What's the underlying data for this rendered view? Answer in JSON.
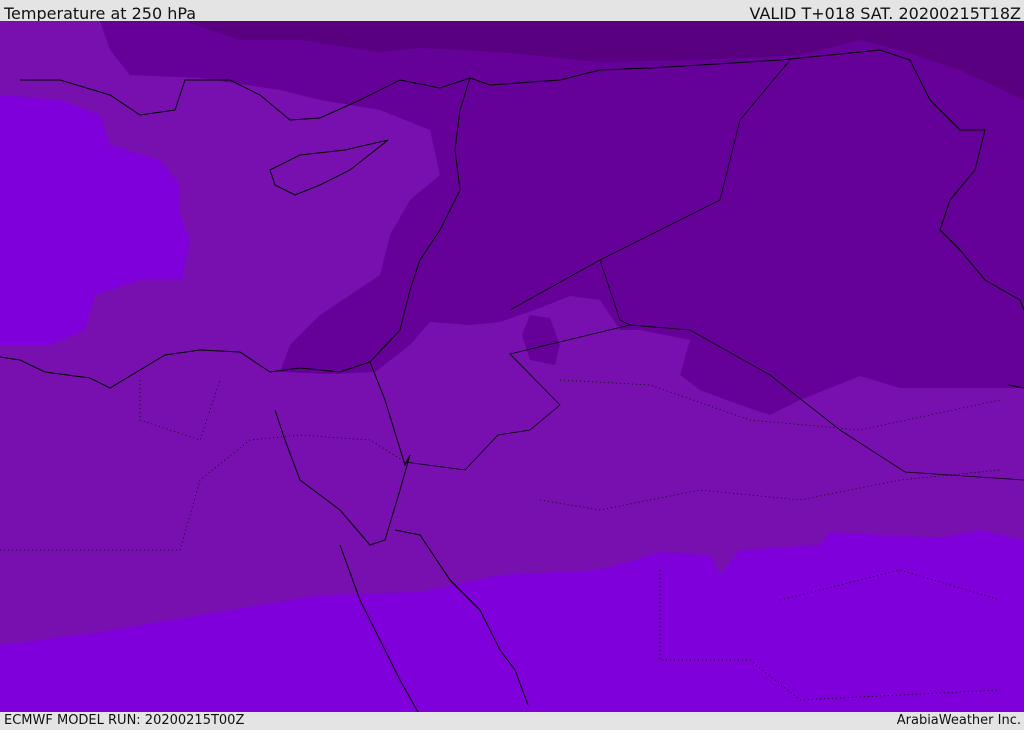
{
  "header": {
    "title": "Temperature at 250 hPa",
    "valid": "VALID T+018 SAT. 20200215T18Z"
  },
  "footer": {
    "model_run": "ECMWF MODEL RUN: 20200215T00Z",
    "credit": "ArabiaWeather Inc."
  },
  "colors": {
    "coldest": "#580080",
    "cold": "#650098",
    "mid": "#7810b0",
    "warm": "#8000dc",
    "border": "#000000"
  }
}
